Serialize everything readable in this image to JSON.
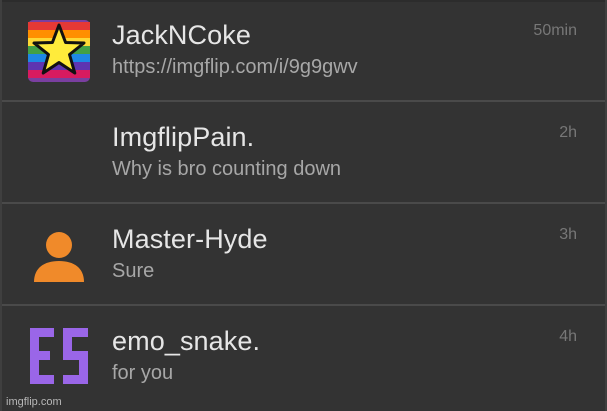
{
  "conversations": [
    {
      "username": "JackNCoke",
      "preview": "https://imgflip.com/i/9g9gwv",
      "time": "50min",
      "avatar": "rainbow-star-icon"
    },
    {
      "username": "ImgflipPain.",
      "preview": "Why is bro counting down",
      "time": "2h",
      "avatar": "none"
    },
    {
      "username": "Master-Hyde",
      "preview": "Sure",
      "time": "3h",
      "avatar": "default-user-icon"
    },
    {
      "username": "emo_snake.",
      "preview": "for you",
      "time": "4h",
      "avatar": "es-letters-icon"
    }
  ],
  "colors": {
    "background": "#333333",
    "divider": "#4a4a4a",
    "username": "#e6e6e6",
    "preview": "#a7a7a7",
    "time": "#777777",
    "avatar_orange": "#f08a2a",
    "avatar_purple": "#9a66e8"
  },
  "watermark": "imgflip.com"
}
